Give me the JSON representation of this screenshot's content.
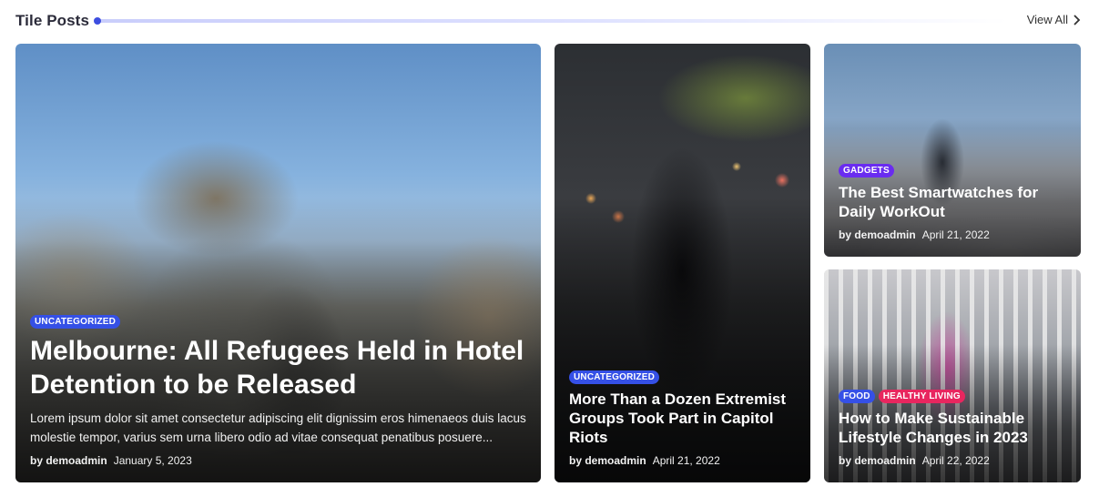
{
  "section": {
    "title": "Tile Posts",
    "view_all": "View All"
  },
  "posts": [
    {
      "badges": [
        "Uncategorized"
      ],
      "title": "Melbourne: All Refugees Held in Hotel Detention to be Released",
      "excerpt": "Lorem ipsum dolor sit amet consectetur adipiscing elit dignissim eros himenaeos duis lacus molestie tempor, varius sem urna libero odio ad vitae consequat penatibus posuere...",
      "author": "by demoadmin",
      "date": "January 5, 2023"
    },
    {
      "badges": [
        "Uncategorized"
      ],
      "title": "More Than a Dozen Extremist Groups Took Part in Capitol Riots",
      "author": "by demoadmin",
      "date": "April 21, 2022"
    },
    {
      "badges": [
        "Gadgets"
      ],
      "title": "The Best Smartwatches for Daily WorkOut",
      "author": "by demoadmin",
      "date": "April 21, 2022"
    },
    {
      "badges": [
        "Food",
        "Healthy Living"
      ],
      "title": "How to Make Sustainable Lifestyle Changes in 2023",
      "author": "by demoadmin",
      "date": "April 22, 2022"
    }
  ],
  "colors": {
    "badge_blue": "#3550e6",
    "badge_purple": "#6a2cf0",
    "badge_pink": "#e8265f",
    "accent": "#3d4ee0"
  }
}
